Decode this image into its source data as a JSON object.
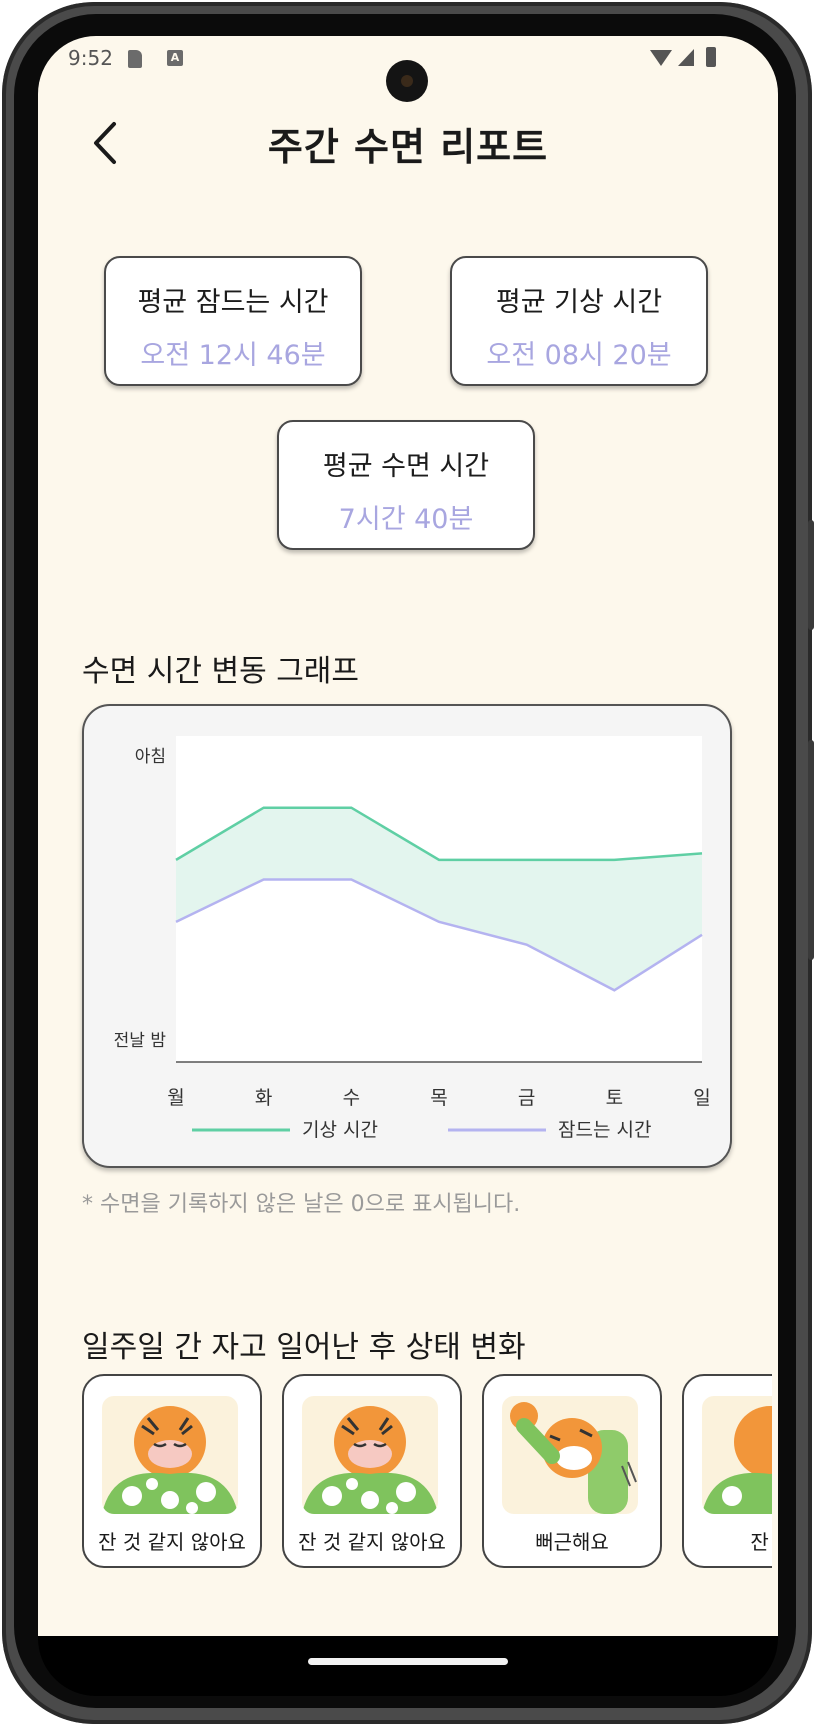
{
  "status_bar": {
    "time": "9:52",
    "a_icon_letter": "A"
  },
  "header": {
    "title": "주간 수면 리포트",
    "back_icon": "chevron-left-icon"
  },
  "summary": {
    "avg_sleep_time": {
      "label": "평균 잠드는 시간",
      "value": "오전 12시 46분"
    },
    "avg_wake_time": {
      "label": "평균 기상 시간",
      "value": "오전 08시 20분"
    },
    "avg_duration": {
      "label": "평균 수면 시간",
      "value": "7시간 40분"
    }
  },
  "graph_section": {
    "title": "수면 시간 변동 그래프",
    "note": "* 수면을 기록하지 않은 날은 0으로 표시됩니다."
  },
  "chart_data": {
    "type": "area",
    "categories": [
      "월",
      "화",
      "수",
      "목",
      "금",
      "토",
      "일"
    ],
    "y_top_label": "아침",
    "y_bottom_label": "전날 밤",
    "ylim": [
      0,
      100
    ],
    "series": [
      {
        "name": "기상 시간",
        "color": "#5fcfa4",
        "values": [
          62,
          78,
          78,
          62,
          62,
          62,
          64
        ]
      },
      {
        "name": "잠드는 시간",
        "color": "#b4b3f0",
        "values": [
          43,
          56,
          56,
          43,
          36,
          22,
          39
        ]
      }
    ],
    "fill_color": "#e3f5ee",
    "legend_position": "bottom"
  },
  "mood_section": {
    "title": "일주일 간 자고 일어난 후 상태 변화",
    "items": [
      {
        "label": "잔 것 같지 않아요",
        "icon": "tired-tiger-icon"
      },
      {
        "label": "잔 것 같지 않아요",
        "icon": "tired-tiger-icon"
      },
      {
        "label": "뻐근해요",
        "icon": "stiff-tiger-icon"
      },
      {
        "label": "잔 것",
        "icon": "tired-tiger-icon"
      }
    ]
  },
  "colors": {
    "background": "#fdf8ec",
    "accent_value": "#a8a6e0",
    "wake_line": "#5fcfa4",
    "sleep_line": "#b4b3f0"
  }
}
